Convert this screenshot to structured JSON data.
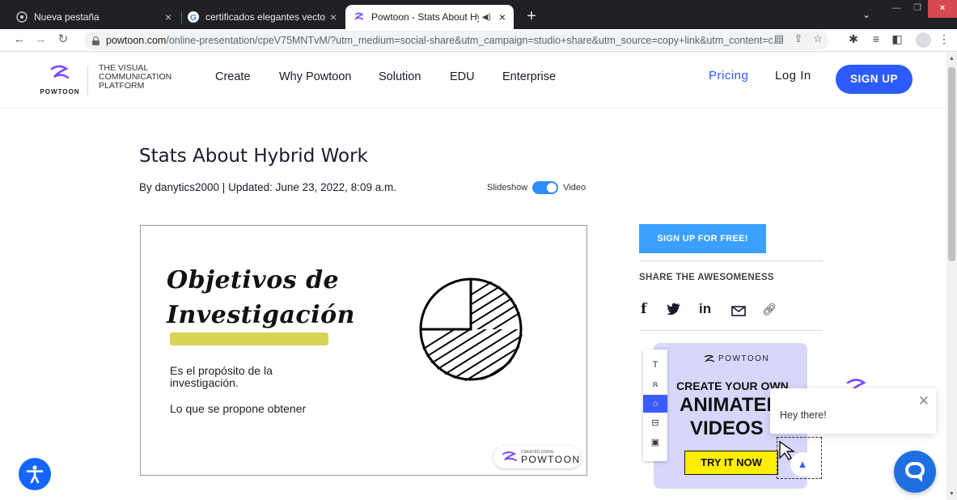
{
  "browser": {
    "tabs": [
      {
        "title": "Nueva pestaña",
        "active": false
      },
      {
        "title": "certificados elegantes vectores -",
        "active": false
      },
      {
        "title": "Powtoon - Stats About Hybr",
        "active": true
      }
    ],
    "close_glyph": "×",
    "new_tab_glyph": "+",
    "url_domain": "powtoon.com",
    "url_rest": "/online-presentation/cpeV75MNTvM/?utm_medium=social-share&utm_campaign=studio+share&utm_source=copy+link&utm_content=c...",
    "tab_search_glyph": "⌄",
    "minimize_glyph": "—",
    "maximize_glyph": "❐",
    "window_close_glyph": "×"
  },
  "header": {
    "logo_word": "POWTOON",
    "tagline": [
      "THE VISUAL",
      "COMMUNICATION",
      "PLATFORM"
    ],
    "nav": [
      "Create",
      "Why Powtoon",
      "Solution",
      "EDU",
      "Enterprise"
    ],
    "pricing": "Pricing",
    "login": "Log In",
    "signup": "SIGN UP"
  },
  "main": {
    "title": "Stats About Hybrid Work",
    "byline": "By danytics2000  |  Updated: June 23, 2022, 8:09 a.m.",
    "toggle_left": "Slideshow",
    "toggle_right": "Video",
    "toggle_on": true
  },
  "slide": {
    "title_line1": "Objetivos de",
    "title_line2": "Investigación",
    "text1": "Es el propósito de la investigación.",
    "text2": "Lo que se propone obtener",
    "badge_small": "CREATED USING",
    "badge_big": "POWTOON",
    "highlight_color": "#d8d456"
  },
  "sidebar": {
    "free_button": "SIGN UP FOR FREE!",
    "share_title": "SHARE THE AWESOMENESS",
    "share_icons": [
      "facebook-icon",
      "twitter-icon",
      "linkedin-icon",
      "email-icon",
      "link-icon"
    ],
    "share_glyphs": {
      "facebook": "f",
      "linkedin": "in",
      "link": "🔗︎"
    }
  },
  "promo": {
    "logo_word": "POWTOON",
    "line1": "CREATE YOUR OWN",
    "line2": "ANIMATED",
    "line3": "VIDEOS",
    "button": "TRY IT NOW",
    "tools": [
      "T",
      "ጸ",
      "⌂",
      "⊟",
      "▣"
    ],
    "play_glyph": "▲",
    "accent": "#3a5bff",
    "button_color": "#ffee00"
  },
  "chat": {
    "greeting": "Hey there!",
    "close_glyph": "✕"
  },
  "colors": {
    "brand_blue": "#2e5bff",
    "free_button": "#3ba0ff",
    "chrome_dark": "#202124"
  }
}
